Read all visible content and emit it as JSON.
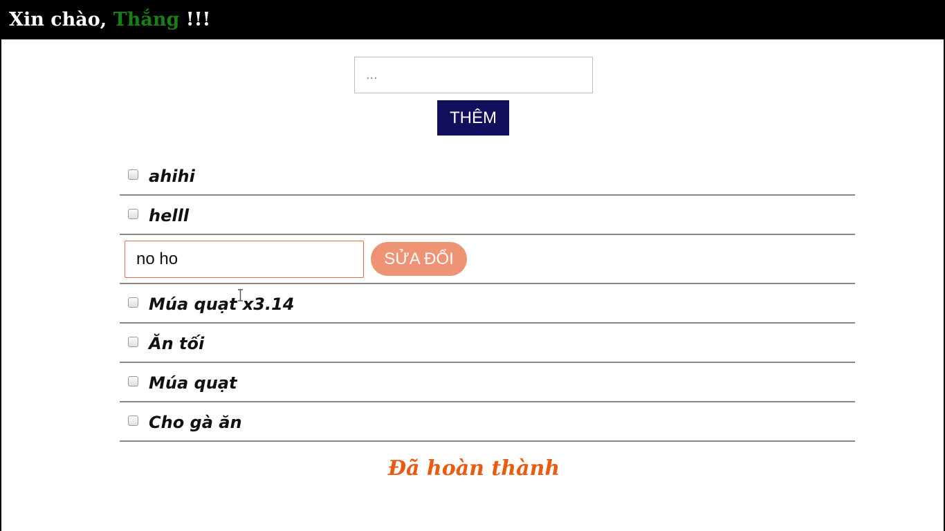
{
  "header": {
    "greeting": "Xin chào, ",
    "username": "Thắng",
    "suffix": " !!!"
  },
  "new_task": {
    "placeholder": "...",
    "value": "",
    "add_label": "THÊM"
  },
  "tasks": [
    {
      "label": "ahihi",
      "checked": false
    },
    {
      "label": "helll",
      "checked": false
    },
    {
      "editing": true,
      "value": "no ho",
      "save_label": "SỬA ĐỔI"
    },
    {
      "label": "Múa quạt x3.14",
      "checked": false
    },
    {
      "label": "Ăn tối",
      "checked": false
    },
    {
      "label": "Múa quạt",
      "checked": false
    },
    {
      "label": "Cho gà ăn",
      "checked": false
    }
  ],
  "completed_section": {
    "title": "Đã hoàn thành"
  },
  "colors": {
    "header_bg": "#000000",
    "username": "#168016",
    "add_button": "#12105c",
    "edit_button": "#ef9375",
    "edit_border": "#e4704b",
    "completed_title": "#ea5b12"
  }
}
